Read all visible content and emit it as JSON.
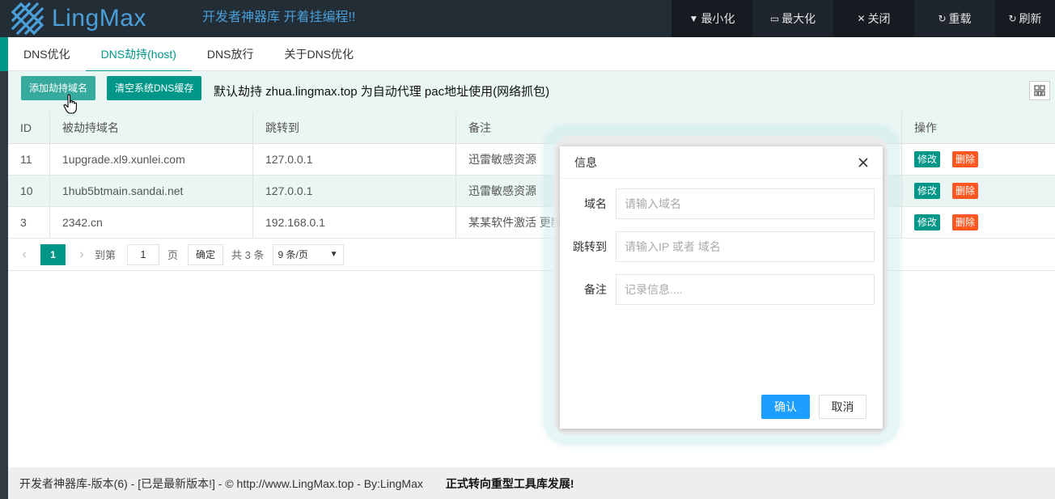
{
  "header": {
    "logo_text": "LingMax",
    "slogan": "开发者神器库 开着挂编程!!",
    "buttons": {
      "minimize": "最小化",
      "maximize": "最大化",
      "close": "关闭",
      "reload": "重载",
      "refresh": "刷新"
    }
  },
  "tabs": [
    {
      "label": "DNS优化"
    },
    {
      "label": "DNS劫持(host)"
    },
    {
      "label": "DNS放行"
    },
    {
      "label": "关于DNS优化"
    }
  ],
  "active_tab": "DNS劫持(host)",
  "toolbar": {
    "add_label": "添加劫持域名",
    "clear_label": "清空系统DNS缓存",
    "notice": "默认劫持 zhua.lingmax.top 为自动代理 pac地址使用(网络抓包)"
  },
  "table": {
    "columns": [
      "ID",
      "被劫持域名",
      "跳转到",
      "备注",
      "操作"
    ],
    "rows": [
      {
        "id": "11",
        "domain": "1upgrade.xl9.xunlei.com",
        "target": "127.0.0.1",
        "note": "迅雷敏感资源"
      },
      {
        "id": "10",
        "domain": "1hub5btmain.sandai.net",
        "target": "127.0.0.1",
        "note": "迅雷敏感资源"
      },
      {
        "id": "3",
        "domain": "2342.cn",
        "target": "192.168.0.1",
        "note": "某某软件激活 更新"
      }
    ],
    "edit_label": "修改",
    "delete_label": "删除"
  },
  "pager": {
    "current_page": "1",
    "goto_label": "到第",
    "goto_value": "1",
    "page_unit": "页",
    "confirm_label": "确定",
    "total_text": "共 3 条",
    "page_size": "9 条/页"
  },
  "footer": {
    "text": "开发者神器库-版本(6) - [已是最新版本!] - © http://www.LingMax.top - By:LingMax",
    "slogan": "正式转向重型工具库发展!"
  },
  "dialog": {
    "title": "信息",
    "fields": [
      {
        "label": "域名",
        "placeholder": "请输入域名"
      },
      {
        "label": "跳转到",
        "placeholder": "请输入IP 或者 域名"
      },
      {
        "label": "备注",
        "placeholder": "记录信息...."
      }
    ],
    "ok_label": "确认",
    "cancel_label": "取消"
  },
  "colors": {
    "header_bg": "#232d36",
    "accent_green": "#009688",
    "danger_orange": "#ff5722",
    "primary_blue": "#1e9fff",
    "brand_blue": "#4a9fd8"
  }
}
